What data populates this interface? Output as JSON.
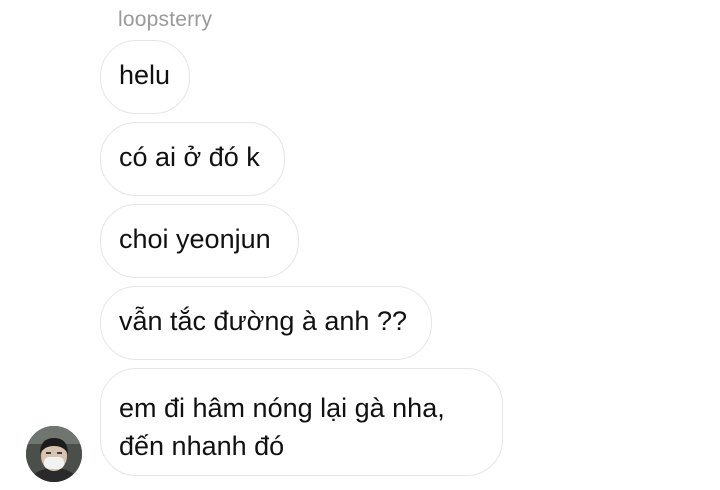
{
  "chat": {
    "sender_name": "loopsterry",
    "messages": [
      {
        "text": "helu"
      },
      {
        "text": "có ai ở đó k"
      },
      {
        "text": "choi yeonjun"
      },
      {
        "text": "vẫn tắc đường à anh ??"
      },
      {
        "lines": [
          "em đi hâm nóng lại gà nha,",
          "đến nhanh đó"
        ]
      }
    ],
    "avatar": {
      "icon": "profile-avatar",
      "colors": {
        "hair": "#1c1c1c",
        "mask": "#f2f2f2",
        "skin": "#d8c2b0",
        "background": "#4a4f4a"
      }
    }
  },
  "theme": {
    "bubble_border": "#e6e6e6",
    "text": "#111111",
    "sender_text": "#9a9a9a",
    "background": "#ffffff"
  }
}
